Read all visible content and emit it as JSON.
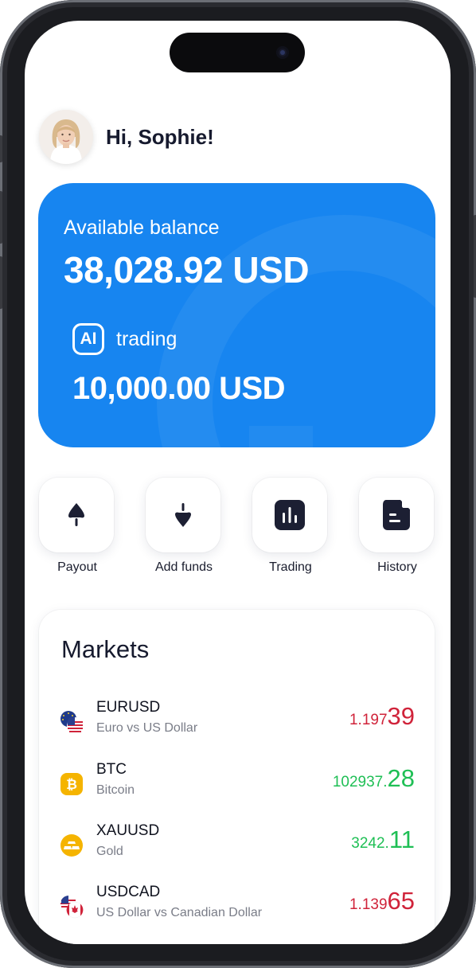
{
  "greeting": {
    "text": "Hi, Sophie!"
  },
  "balance": {
    "label": "Available balance",
    "value": "38,028.92 USD",
    "ai_badge": "AI",
    "ai_label": "trading",
    "ai_value": "10,000.00 USD"
  },
  "actions": [
    {
      "label": "Payout",
      "icon": "arrow-up-icon"
    },
    {
      "label": "Add funds",
      "icon": "arrow-down-icon"
    },
    {
      "label": "Trading",
      "icon": "bar-chart-icon"
    },
    {
      "label": "History",
      "icon": "document-icon"
    }
  ],
  "markets": {
    "title": "Markets",
    "rows": [
      {
        "symbol": "EURUSD",
        "desc": "Euro vs US Dollar",
        "price_small": "1.197",
        "price_big": "39",
        "trend": "down",
        "icon": "eu-us-flags-icon"
      },
      {
        "symbol": "BTC",
        "desc": "Bitcoin",
        "price_small": "102937.",
        "price_big": "28",
        "trend": "up",
        "icon": "bitcoin-icon"
      },
      {
        "symbol": "XAUUSD",
        "desc": "Gold",
        "price_small": "3242.",
        "price_big": "11",
        "trend": "up",
        "icon": "gold-icon"
      },
      {
        "symbol": "USDCAD",
        "desc": "US Dollar vs Canadian Dollar",
        "price_small": "1.139",
        "price_big": "65",
        "trend": "down",
        "icon": "us-ca-flags-icon"
      }
    ]
  },
  "colors": {
    "accent": "#1785f0",
    "up": "#1fbf55",
    "down": "#d0233a",
    "gold": "#f5b400"
  }
}
